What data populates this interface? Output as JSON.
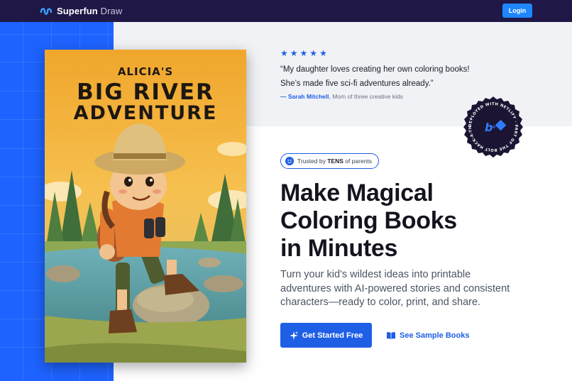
{
  "header": {
    "brand_name": "Superfun",
    "brand_suffix": "Draw",
    "login_label": "Login"
  },
  "testimonial": {
    "rating": 5,
    "quote_line1": "“My daughter loves creating her own coloring books!",
    "quote_line2": "She’s made five sci-fi adventures already.”",
    "author": "— Sarah Mitchell",
    "author_detail": ", Mom of three creative kids"
  },
  "seal": {
    "text": "DEPLOYED WITH NETLIFY · PART OF THE BOLT HACK-A-THON · "
  },
  "book": {
    "subtitle": "ALICIA'S",
    "title_line1": "BIG RIVER",
    "title_line2": "ADVENTURE"
  },
  "hero": {
    "trust_prefix": "Trusted by ",
    "trust_emphasis": "TENS",
    "trust_suffix": " of parents",
    "title_line1": "Make Magical",
    "title_line2": "Coloring Books",
    "title_line3": "in Minutes",
    "desc_line1": "Turn your kid's wildest ideas into printable",
    "desc_line2": "adventures with AI-powered stories and consistent",
    "desc_line3": "characters—ready to color, print, and share.",
    "cta_primary": "Get Started Free",
    "cta_secondary": "See Sample Books"
  },
  "colors": {
    "header_bg": "#1f1846",
    "accent_blue": "#1f5fe6",
    "side_panel": "#1e63ff",
    "login_bg": "#1f86ff"
  },
  "icons": {
    "brand": "squiggle-logo-icon",
    "star": "star-icon",
    "smile": "smile-icon",
    "sparkle": "sparkle-icon",
    "book": "open-book-icon"
  }
}
